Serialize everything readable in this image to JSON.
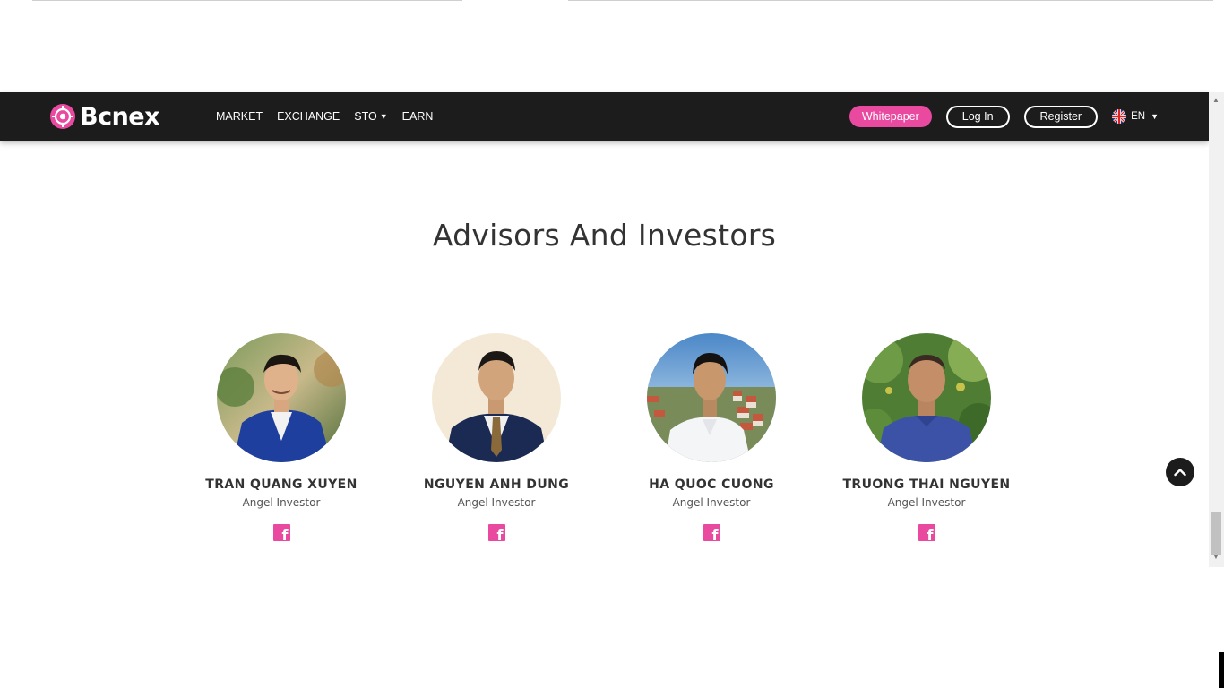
{
  "brand": {
    "name": "Bcnex",
    "accent": "#e94aa0",
    "nav_bg": "#1c1c1c"
  },
  "nav": {
    "links": [
      {
        "label": "MARKET"
      },
      {
        "label": "EXCHANGE"
      },
      {
        "label": "STO",
        "dropdown": true
      },
      {
        "label": "EARN"
      }
    ],
    "whitepaper_label": "Whitepaper",
    "login_label": "Log In",
    "register_label": "Register",
    "language": "EN"
  },
  "section": {
    "title": "Advisors And Investors",
    "people": [
      {
        "name": "TRAN QUANG XUYEN",
        "role": "Angel Investor",
        "icon": "facebook-icon"
      },
      {
        "name": "NGUYEN ANH DUNG",
        "role": "Angel Investor",
        "icon": "facebook-icon"
      },
      {
        "name": "HA QUOC CUONG",
        "role": "Angel Investor",
        "icon": "facebook-icon"
      },
      {
        "name": "TRUONG THAI NGUYEN",
        "role": "Angel Investor",
        "icon": "facebook-icon"
      }
    ]
  },
  "icons": {
    "back_to_top": "chevron-up-icon",
    "language_flag": "uk-flag-icon"
  }
}
